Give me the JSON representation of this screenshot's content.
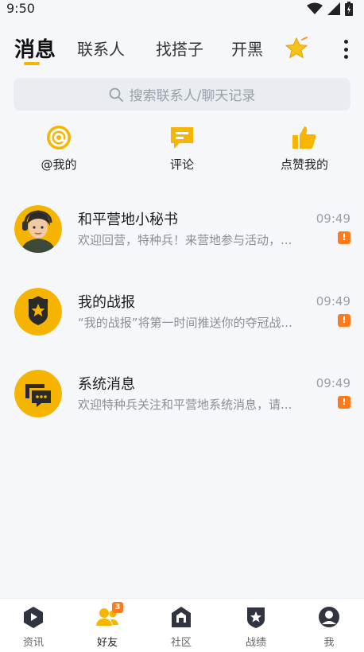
{
  "status_bar": {
    "time": "9:50"
  },
  "tabs": [
    {
      "label": "消息"
    },
    {
      "label": "联系人"
    },
    {
      "label": "找搭子"
    },
    {
      "label": "开黑"
    }
  ],
  "search": {
    "placeholder": "搜索联系人/聊天记录"
  },
  "quick_actions": [
    {
      "label": "@我的",
      "icon": "at-icon"
    },
    {
      "label": "评论",
      "icon": "comment-icon"
    },
    {
      "label": "点赞我的",
      "icon": "thumbs-up-icon"
    }
  ],
  "chats": [
    {
      "name": "和平营地小秘书",
      "preview": "欢迎回营，特种兵！来营地参与活动，...",
      "time": "09:49",
      "badge": "!"
    },
    {
      "name": "我的战报",
      "preview": "“我的战报”将第一时间推送你的夺冠战...",
      "time": "09:49",
      "badge": "!"
    },
    {
      "name": "系统消息",
      "preview": "欢迎特种兵关注和平营地系统消息，请...",
      "time": "09:49",
      "badge": "!"
    }
  ],
  "bottom_nav": [
    {
      "label": "资讯"
    },
    {
      "label": "好友",
      "badge": "3"
    },
    {
      "label": "社区"
    },
    {
      "label": "战绩"
    },
    {
      "label": "我"
    }
  ],
  "colors": {
    "accent": "#f5b800",
    "badge": "#ff7a1a",
    "background": "#f5f7fa"
  }
}
